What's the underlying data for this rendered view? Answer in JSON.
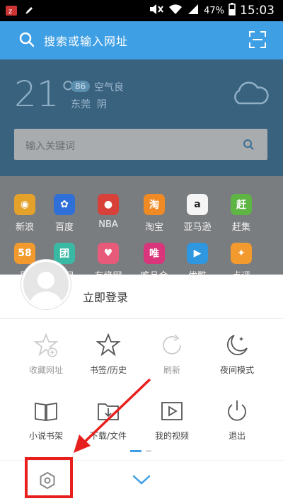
{
  "status_bar": {
    "battery": "47%",
    "time": "15:03"
  },
  "search": {
    "placeholder": "搜索或输入网址"
  },
  "weather": {
    "temperature": "21°",
    "aqi_value": "86",
    "aqi_label": "空气良",
    "city": "东莞",
    "condition": "阴"
  },
  "keyword_box": {
    "placeholder": "输入关键词"
  },
  "apps": [
    {
      "label": "新浪",
      "color": "#e4a22b",
      "glyph": "◉"
    },
    {
      "label": "百度",
      "color": "#2f6fd8",
      "glyph": "✿"
    },
    {
      "label": "NBA",
      "color": "#d8403a",
      "glyph": "●"
    },
    {
      "label": "淘宝",
      "color": "#f08a24",
      "glyph": "淘"
    },
    {
      "label": "亚马逊",
      "color": "#f5f5f5",
      "glyph": "a"
    },
    {
      "label": "赶集",
      "color": "#5fb544",
      "glyph": "赶"
    },
    {
      "label": "同",
      "color": "#f29a2e",
      "glyph": "58"
    },
    {
      "label": "团网",
      "color": "#39b9a4",
      "glyph": "团"
    },
    {
      "label": "有缘网",
      "color": "#e85a7a",
      "glyph": "♥"
    },
    {
      "label": "唯品会",
      "color": "#d8357a",
      "glyph": "唯"
    },
    {
      "label": "优酷",
      "color": "#2e97e0",
      "glyph": "▶"
    },
    {
      "label": "点评",
      "color": "#f29a2e",
      "glyph": "✦"
    }
  ],
  "sheet": {
    "login_label": "立即登录",
    "menu": [
      {
        "label": "收藏网址",
        "icon": "star-plus-icon",
        "disabled": true
      },
      {
        "label": "书签/历史",
        "icon": "star-icon",
        "disabled": false
      },
      {
        "label": "刷新",
        "icon": "refresh-icon",
        "disabled": true
      },
      {
        "label": "夜间模式",
        "icon": "moon-icon",
        "disabled": false
      },
      {
        "label": "小说书架",
        "icon": "book-icon",
        "disabled": false
      },
      {
        "label": "下载/文件",
        "icon": "download-folder-icon",
        "disabled": false
      },
      {
        "label": "我的视频",
        "icon": "video-icon",
        "disabled": false
      },
      {
        "label": "退出",
        "icon": "power-icon",
        "disabled": false
      }
    ]
  },
  "colors": {
    "accent": "#3f9fe4",
    "highlight": "#e8201d"
  }
}
